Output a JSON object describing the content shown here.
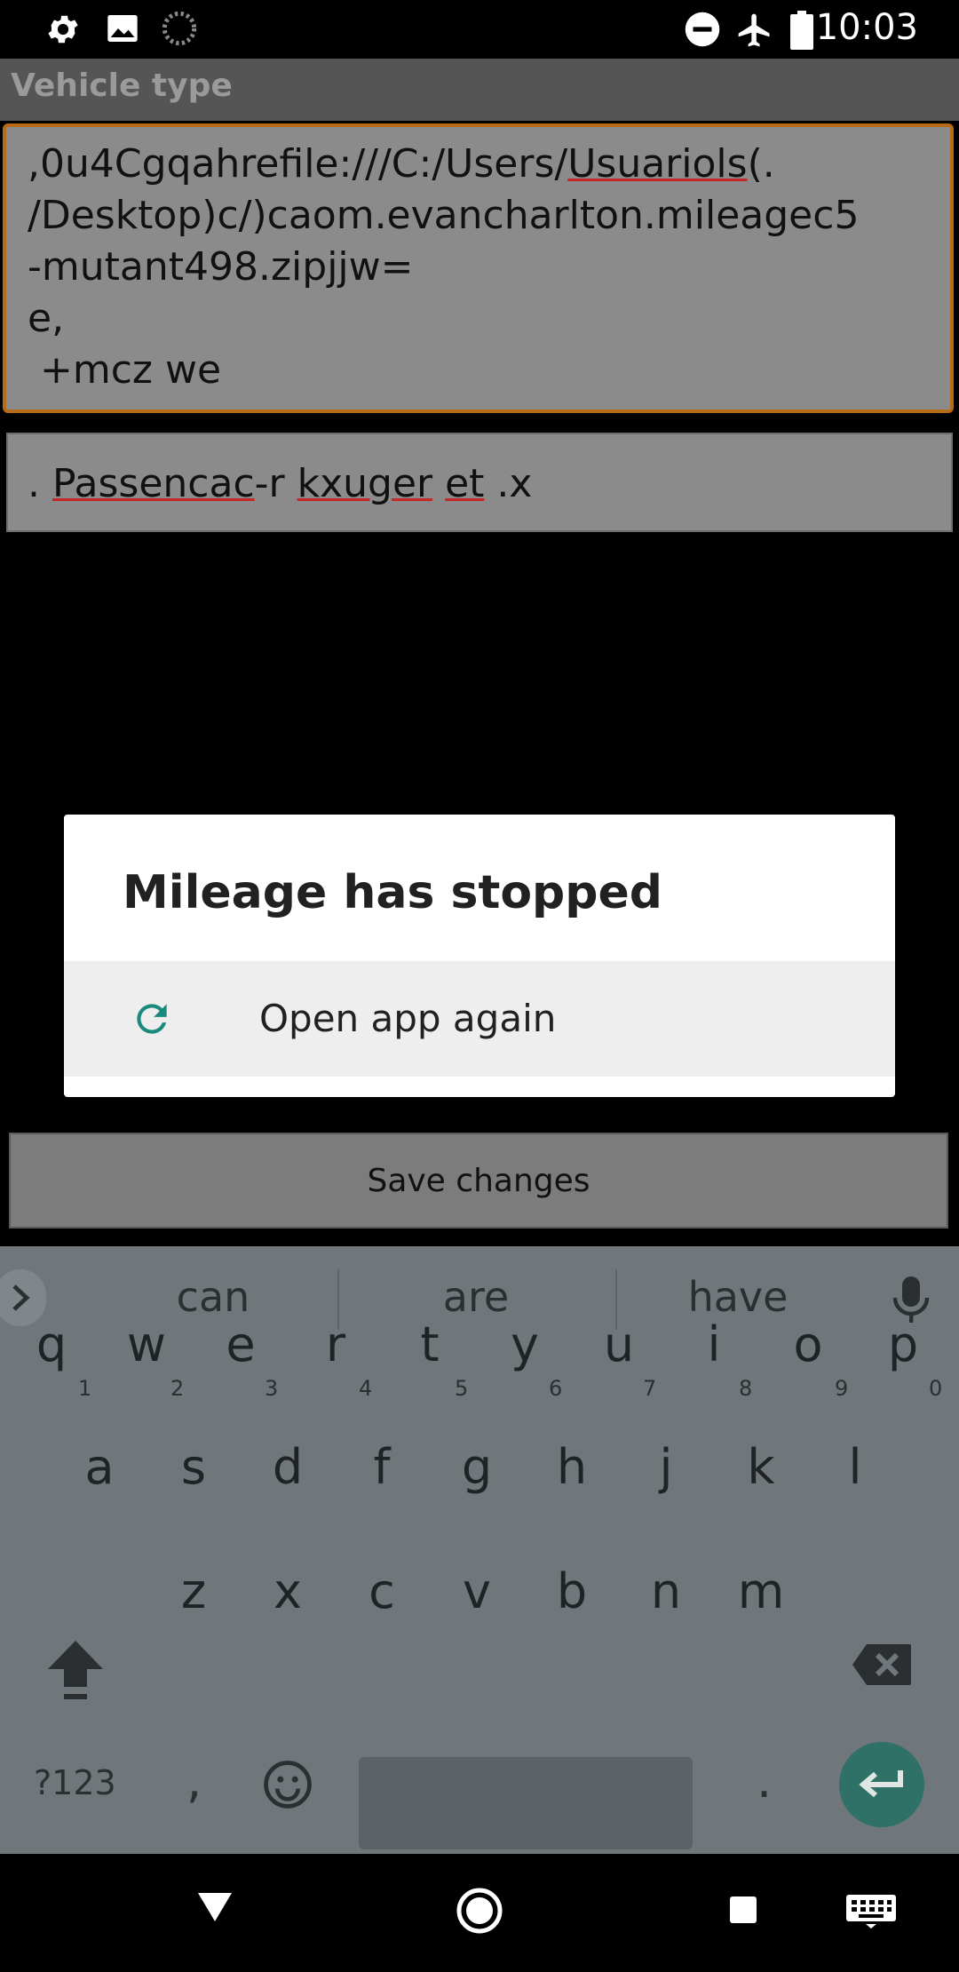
{
  "status_bar": {
    "time": "10:03",
    "left_icons": [
      "settings-icon",
      "image-icon",
      "loading-icon"
    ],
    "right_icons": [
      "do-not-disturb-icon",
      "airplane-mode-icon",
      "battery-icon"
    ]
  },
  "app": {
    "title": "Vehicle type",
    "notes_lines": [
      ",0u4Cgqahrefile:///C:/Users/",
      "Usuariols",
      "(.",
      "/Desktop)c/)caom.evancharlton.mileagec5",
      "-mutant498.zipjjw=",
      "e,",
      " +mcz we"
    ],
    "vehicle_type_value": {
      "p1": ". ",
      "w1": "Passencac",
      "p2": "-r ",
      "w2": "kxuger",
      "p3": " ",
      "w3": "et",
      "p4": " .x"
    },
    "save_label": "Save changes"
  },
  "dialog": {
    "title": "Mileage has stopped",
    "option_label": "Open app again",
    "option_icon": "refresh-icon"
  },
  "keyboard": {
    "suggestions": [
      "can",
      "are",
      "have"
    ],
    "row1": [
      "q",
      "w",
      "e",
      "r",
      "t",
      "y",
      "u",
      "i",
      "o",
      "p"
    ],
    "row1_hints": [
      "1",
      "2",
      "3",
      "4",
      "5",
      "6",
      "7",
      "8",
      "9",
      "0"
    ],
    "row2": [
      "a",
      "s",
      "d",
      "f",
      "g",
      "h",
      "j",
      "k",
      "l"
    ],
    "row3": [
      "z",
      "x",
      "c",
      "v",
      "b",
      "n",
      "m"
    ],
    "symbols_label": "?123",
    "comma": ",",
    "period": ".",
    "colors": {
      "background": "#6f777b",
      "enter": "#2f7067"
    }
  },
  "nav_bar": {
    "icons": [
      "back-icon",
      "home-icon",
      "recents-icon",
      "keyboard-icon"
    ]
  }
}
